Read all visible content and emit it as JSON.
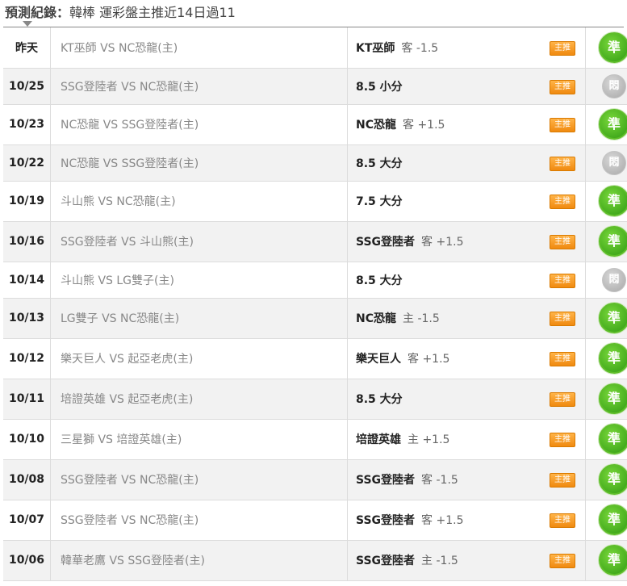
{
  "header": {
    "title": "預測紀錄：",
    "subtitle": "韓棒 運彩盤主推近14日過11"
  },
  "colors": {
    "win": "#3aa516",
    "lose": "#b0b0b0",
    "badge": "#f5a028"
  },
  "rows": [
    {
      "date": "昨天",
      "match": "KT巫師 VS NC恐龍(主)",
      "pick": "KT巫師",
      "side": "客 -1.5",
      "badge": "主推",
      "result": "準",
      "type": "win"
    },
    {
      "date": "10/25",
      "match": "SSG登陸者 VS NC恐龍(主)",
      "pick": "8.5 小分",
      "side": "",
      "badge": "主推",
      "result": "悶",
      "type": "lose"
    },
    {
      "date": "10/23",
      "match": "NC恐龍 VS SSG登陸者(主)",
      "pick": "NC恐龍",
      "side": "客 +1.5",
      "badge": "主推",
      "result": "準",
      "type": "win"
    },
    {
      "date": "10/22",
      "match": "NC恐龍 VS SSG登陸者(主)",
      "pick": "8.5 大分",
      "side": "",
      "badge": "主推",
      "result": "悶",
      "type": "lose"
    },
    {
      "date": "10/19",
      "match": "斗山熊 VS NC恐龍(主)",
      "pick": "7.5 大分",
      "side": "",
      "badge": "主推",
      "result": "準",
      "type": "win"
    },
    {
      "date": "10/16",
      "match": "SSG登陸者 VS 斗山熊(主)",
      "pick": "SSG登陸者",
      "side": "客 +1.5",
      "badge": "主推",
      "result": "準",
      "type": "win"
    },
    {
      "date": "10/14",
      "match": "斗山熊 VS LG雙子(主)",
      "pick": "8.5 大分",
      "side": "",
      "badge": "主推",
      "result": "悶",
      "type": "lose"
    },
    {
      "date": "10/13",
      "match": "LG雙子 VS NC恐龍(主)",
      "pick": "NC恐龍",
      "side": "主 -1.5",
      "badge": "主推",
      "result": "準",
      "type": "win"
    },
    {
      "date": "10/12",
      "match": "樂天巨人 VS 起亞老虎(主)",
      "pick": "樂天巨人",
      "side": "客 +1.5",
      "badge": "主推",
      "result": "準",
      "type": "win"
    },
    {
      "date": "10/11",
      "match": "培證英雄 VS 起亞老虎(主)",
      "pick": "8.5 大分",
      "side": "",
      "badge": "主推",
      "result": "準",
      "type": "win"
    },
    {
      "date": "10/10",
      "match": "三星獅 VS 培證英雄(主)",
      "pick": "培證英雄",
      "side": "主 +1.5",
      "badge": "主推",
      "result": "準",
      "type": "win"
    },
    {
      "date": "10/08",
      "match": "SSG登陸者 VS NC恐龍(主)",
      "pick": "SSG登陸者",
      "side": "客 -1.5",
      "badge": "主推",
      "result": "準",
      "type": "win"
    },
    {
      "date": "10/07",
      "match": "SSG登陸者 VS NC恐龍(主)",
      "pick": "SSG登陸者",
      "side": "客 +1.5",
      "badge": "主推",
      "result": "準",
      "type": "win"
    },
    {
      "date": "10/06",
      "match": "韓華老鷹 VS SSG登陸者(主)",
      "pick": "SSG登陸者",
      "side": "主 -1.5",
      "badge": "主推",
      "result": "準",
      "type": "win"
    }
  ]
}
